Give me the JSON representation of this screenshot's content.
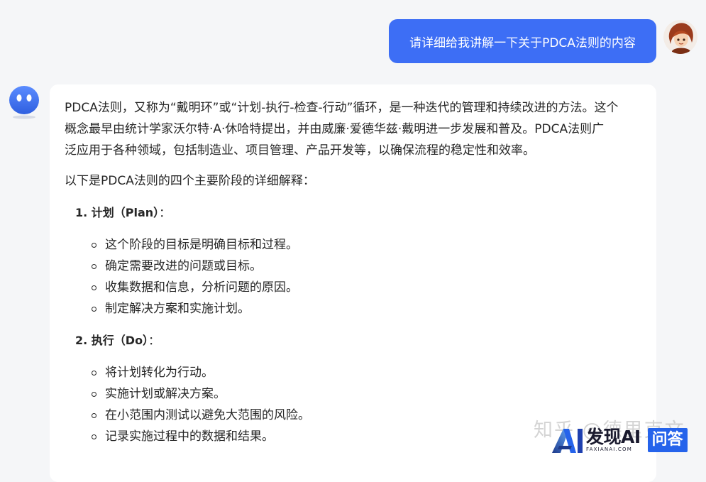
{
  "user_message": {
    "text": "请详细给我讲解一下关于PDCA法则的内容"
  },
  "answer": {
    "intro_line1": "PDCA法则，又称为“戴明环”或“计划-执行-检查-行动”循环，是一种迭代的管理和持续改进的方法。这个",
    "intro_line2": "概念最早由统计学家沃尔特·A·休哈特提出，并由威廉·爱德华兹·戴明进一步发展和普及。PDCA法则广",
    "intro_line3": "泛应用于各种领域，包括制造业、项目管理、产品开发等，以确保流程的稳定性和效率。",
    "lead": "以下是PDCA法则的四个主要阶段的详细解释：",
    "sections": [
      {
        "heading": "1. 计划（Plan）",
        "colon": "：",
        "items": [
          "这个阶段的目标是明确目标和过程。",
          "确定需要改进的问题或目标。",
          "收集数据和信息，分析问题的原因。",
          "制定解决方案和实施计划。"
        ]
      },
      {
        "heading": "2. 执行（Do）",
        "colon": "：",
        "items": [
          "将计划转化为行动。",
          "实施计划或解决方案。",
          "在小范围内测试以避免大范围的风险。",
          "记录实施过程中的数据和结果。"
        ]
      }
    ]
  },
  "watermark": {
    "text": "知乎 @德里克文"
  },
  "logo": {
    "main": "发现AI",
    "sub": "FAXIANAI.COM",
    "badge": "问答",
    "icon": "ai-logo-icon"
  },
  "colors": {
    "user_bubble": "#3d6ef5",
    "bot_avatar": "#3a6ff0",
    "badge": "#2563eb",
    "page_bg": "#f5f6f8"
  }
}
